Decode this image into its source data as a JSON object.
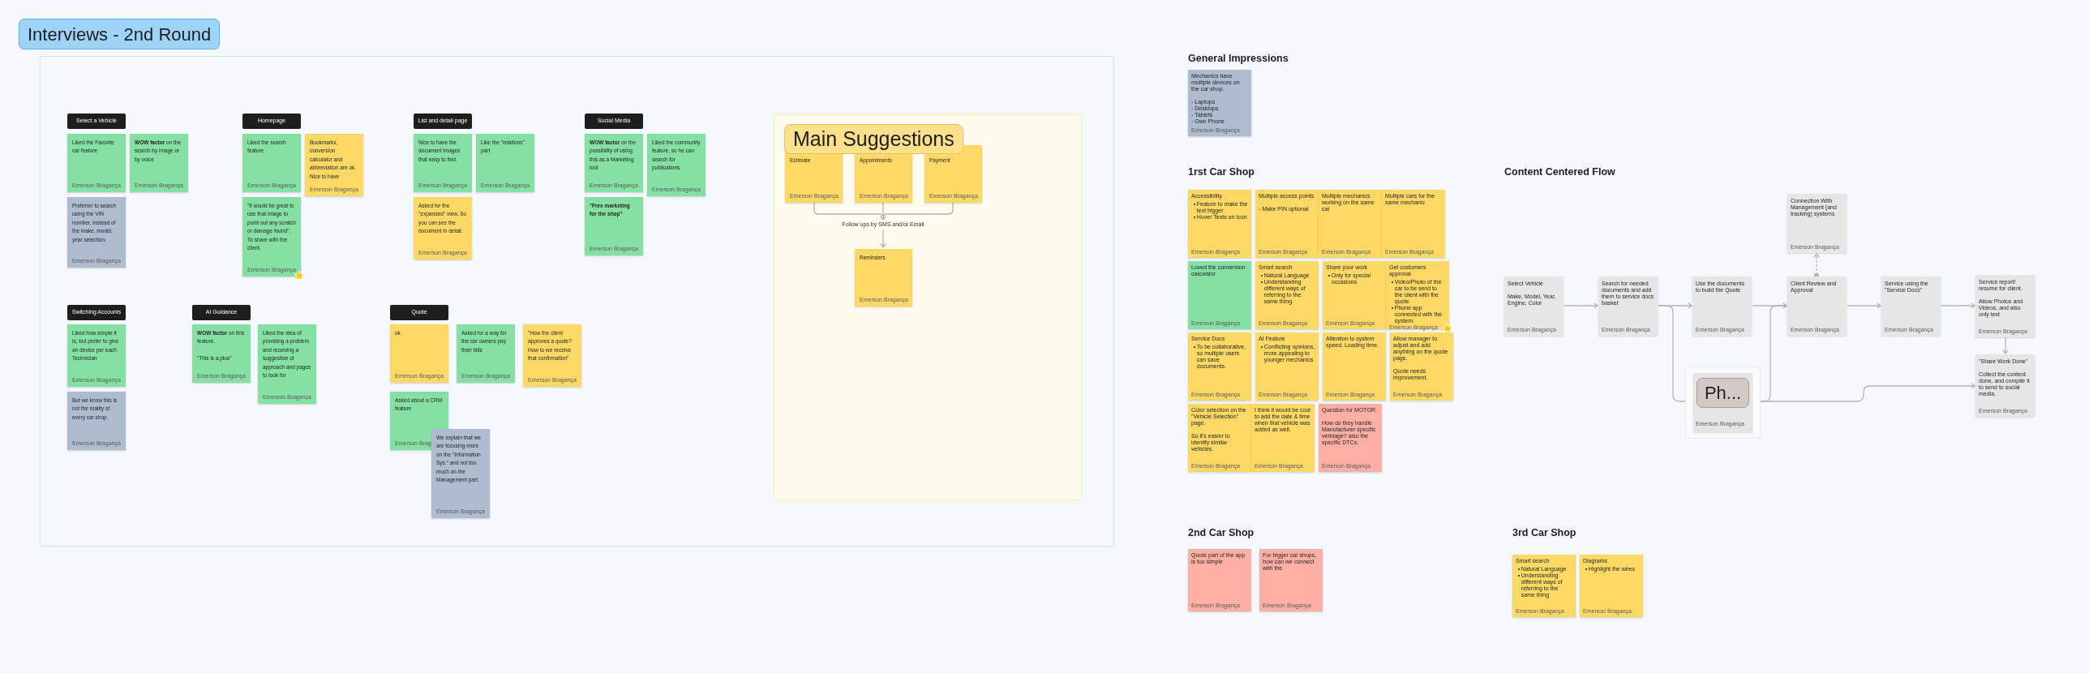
{
  "board_title": "Interviews - 2nd Round",
  "interview_groups": [
    {
      "header": "Select a Vehicle",
      "notes": [
        {
          "text": "Liked the Favorite car feature",
          "color": "#85e0a3",
          "author": "Emerson Bragança",
          "starred": false
        },
        {
          "text": "**WOW factor** on the search by image or by voice",
          "color": "#85e0a3",
          "author": "Emerson Bragança",
          "starred": false
        },
        {
          "text": "Preferrer to search using the VIN number, instead of the make, model, year selection.",
          "color": "#afbccf",
          "author": "Emerson Bragança",
          "starred": false
        }
      ]
    },
    {
      "header": "Homepage",
      "notes": [
        {
          "text": "Liked the search feature",
          "color": "#85e0a3",
          "author": "Emerson Bragança",
          "starred": false
        },
        {
          "text": "Bookmarks, conversion calculator and abbreviation are ok. Nice to have",
          "color": "#ffd966",
          "author": "Emerson Bragança",
          "starred": false
        },
        {
          "text": "\"It would be great to use that image to point out any scratch or damage found\". To share with the client.",
          "color": "#85e0a3",
          "author": "Emerson Bragança",
          "starred": true
        }
      ]
    },
    {
      "header": "List and detail page",
      "notes": [
        {
          "text": "Nice to have the document images that easy to find.",
          "color": "#85e0a3",
          "author": "Emerson Bragança",
          "starred": false
        },
        {
          "text": "Like the \"relations\" part",
          "color": "#85e0a3",
          "author": "Emerson Bragança",
          "starred": false
        },
        {
          "text": "Asked for the \"expanded\" view. So you can see the document in detail.",
          "color": "#ffd966",
          "author": "Emerson Bragança",
          "starred": false
        }
      ]
    },
    {
      "header": "Social Media",
      "notes": [
        {
          "text": "**WOW factor** on the possibility of using this as a Marketing tool",
          "color": "#85e0a3",
          "author": "Emerson Bragança",
          "starred": false
        },
        {
          "text": "Liked the community feature, so he can search for publications",
          "color": "#85e0a3",
          "author": "Emerson Bragança",
          "starred": false
        },
        {
          "text": "\"Free marketing for the shop\"",
          "emphasis": true,
          "color": "#85e0a3",
          "author": "Emerson Bragança",
          "starred": false
        }
      ]
    },
    {
      "header": "Switching Accounts",
      "notes": [
        {
          "text": "Liked how simple it is, but prefer to give an device per each Technician",
          "color": "#85e0a3",
          "author": "Emerson Bragança",
          "starred": false
        },
        {
          "text": "But we know this is not the reality of every car shop.",
          "color": "#afbccf",
          "author": "Emerson Bragança",
          "starred": false
        }
      ]
    },
    {
      "header": "AI Guidance",
      "notes": [
        {
          "text": "**WOW factor** on this feature.\n\n\"This is a plus\"",
          "color": "#85e0a3",
          "author": "Emerson Bragança",
          "starred": false
        },
        {
          "text": "Liked the idea of providing a problem and receiving a suggestion of approach and pages to look for",
          "color": "#85e0a3",
          "author": "Emerson Bragança",
          "starred": false
        }
      ]
    },
    {
      "header": "Quote",
      "notes": [
        {
          "text": "ok",
          "color": "#ffd966",
          "author": "Emerson Bragança",
          "starred": false
        },
        {
          "text": "Asked for a way for the car owners pay their bills",
          "color": "#85e0a3",
          "author": "Emerson Bragança",
          "starred": false
        },
        {
          "text": "\"How the client approves a quote? How to we receive that confirmation\"",
          "color": "#ffd966",
          "author": "Emerson Bragança",
          "starred": false
        },
        {
          "text": "Asked about a CRM feature",
          "color": "#85e0a3",
          "author": "Emerson Brag",
          "starred": false
        },
        {
          "text": "We explain that we are focusing more on the \"Information Sys.\" and not too much on the Management part.",
          "color": "#afbccf",
          "author": "Emerson Bragança",
          "starred": false
        }
      ]
    }
  ],
  "main_suggestions": {
    "title": "Main Suggestions",
    "notes": [
      {
        "text": "Estimate",
        "color": "#ffd966",
        "author": "Emerson Bragança",
        "starred": false
      },
      {
        "text": "Appointments",
        "color": "#ffd966",
        "author": "Emerson Bragança",
        "starred": false
      },
      {
        "text": "Payment",
        "color": "#ffd966",
        "author": "Emerson Bragança",
        "starred": false
      }
    ],
    "connector_label": "Follow ups by SMS and/or Email",
    "result": {
      "text": "Reminders",
      "color": "#ffd966",
      "author": "Emerson Bragança",
      "starred": false
    }
  },
  "sections": [
    {
      "heading": "General Impressions",
      "notes": [
        {
          "text": "Mechanics have multiple devices on the car shop.\n\n- Laptops\n- Desktops\n- Tablets\n- Own Phone",
          "color": "#afbccf",
          "author": "Emerson Bragança",
          "starred": false
        }
      ]
    },
    {
      "heading": "1rst Car Shop",
      "notes": [
        {
          "text": "Accessibility",
          "bullets": [
            "Feature to make the text bigger",
            "Hover Texts on Icon"
          ],
          "color": "#ffd966",
          "author": "Emerson Bragança",
          "starred": false
        },
        {
          "text": "Multiple access points\n\n- Make PIN optional",
          "color": "#ffd966",
          "author": "Emerson Bragança",
          "starred": false
        },
        {
          "text": "Multiple mechanics working on the same car",
          "color": "#ffd966",
          "author": "Emerson Bragança",
          "starred": false
        },
        {
          "text": "Multiple cars for the same mechanic",
          "color": "#ffd966",
          "author": "Emerson Bragança",
          "starred": false
        },
        {
          "text": "Loved the conversion calculator",
          "color": "#85e0a3",
          "author": "Emerson Bragança",
          "starred": false
        },
        {
          "text": "Smart search",
          "bullets": [
            "Natural Language",
            "Understanding different ways of referring to the same thing"
          ],
          "color": "#ffd966",
          "author": "Emerson Bragança",
          "starred": false
        },
        {
          "text": "Share your work",
          "bullets": [
            "Only for special occasions"
          ],
          "color": "#ffd966",
          "author": "Emerson Bragança",
          "starred": false
        },
        {
          "text": "Get customers approval",
          "bullets": [
            "Video/Photo of the car to be send to the client with the quote",
            "Phone app connected with the system."
          ],
          "color": "#ffd966",
          "author": "Emerson Bragança",
          "starred": true
        },
        {
          "text": "Service Docs",
          "bullets": [
            "To be collaborative, so multiple users can save documents."
          ],
          "color": "#ffd966",
          "author": "Emerson Bragança",
          "starred": false
        },
        {
          "text": "AI Feature",
          "bullets": [
            "Conflicting opinions, more appealing to younger mechanics"
          ],
          "color": "#ffd966",
          "author": "Emerson Bragança",
          "starred": false
        },
        {
          "text": "Attention to system speed.  Loading time.",
          "color": "#ffd966",
          "author": "Emerson Bragança",
          "starred": false
        },
        {
          "text": "Allow manager to adjust and add anything on the quote page.\n\nQuote needs improvement.",
          "color": "#ffd966",
          "author": "Emerson Bragança",
          "starred": false
        },
        {
          "text": "Color selection on the \"Vehicle Selection\" page.\n\nSo it's easier to identify similar vehicles.",
          "color": "#ffd966",
          "author": "Emerson Bragança",
          "starred": false
        },
        {
          "text": "I think it would be cool to add the date & time when that vehicle was added as well.",
          "color": "#ffd966",
          "author": "Emerson Bragança",
          "starred": false
        },
        {
          "text": "Question for MOTOR.\n\nHow do they handle Manufacturer specific verbiage? also the specific DTCs.",
          "color": "#ffafa3",
          "author": "Emerson Bragança",
          "starred": false
        }
      ]
    },
    {
      "heading": "2nd Car Shop",
      "notes": [
        {
          "text": "Quote part of the app is too simple",
          "color": "#ffafa3",
          "author": "Emerson Bragança",
          "starred": false
        },
        {
          "text": "For bigger car shops, how can we connect with the",
          "color": "#ffafa3",
          "author": "Emerson Bragança",
          "starred": false
        }
      ]
    },
    {
      "heading": "3rd Car Shop",
      "notes": [
        {
          "text": "Smart search",
          "bullets": [
            "Natural Language",
            "Understanding different ways of referring to the same thing"
          ],
          "color": "#ffd966",
          "author": "Emerson Bragança",
          "starred": false
        },
        {
          "text": "Diagrams",
          "bullets": [
            "Highlight the wires"
          ],
          "color": "#ffd966",
          "author": "Emerson Bragança",
          "starred": false
        }
      ]
    }
  ],
  "content_flow": {
    "heading": "Content Centered Flow",
    "cards": [
      {
        "kind": "note",
        "text": "Connection With Management (and tracking) systems",
        "author": "Emerson Bragança"
      },
      {
        "kind": "note",
        "text": "Select Vehicle\n\nMake, Model, Year, Engine, Color",
        "author": "Emerson Bragança"
      },
      {
        "kind": "note",
        "text": "Search for needed documents and add them to service docs basket",
        "author": "Emerson Bragança"
      },
      {
        "kind": "note",
        "text": "Use the documents to build the Quote",
        "author": "Emerson Bragança"
      },
      {
        "kind": "note",
        "text": "Client Review and Approval",
        "author": "Emerson Bragança"
      },
      {
        "kind": "note",
        "text": "Service using the \"Service Docs\"",
        "author": "Emerson Bragança"
      },
      {
        "kind": "note",
        "text": "Service report/ resume for client.\n\nAllow Photos and Videos, and also only text",
        "author": "Emerson Bragança"
      },
      {
        "kind": "badge",
        "text": "Ph...",
        "author": "Emerson Bragança"
      },
      {
        "kind": "note",
        "text": "\"Share Work Done\"\n\nCollect the content done, and compile it to send to social media.",
        "author": "Emerson Bragança"
      }
    ]
  }
}
